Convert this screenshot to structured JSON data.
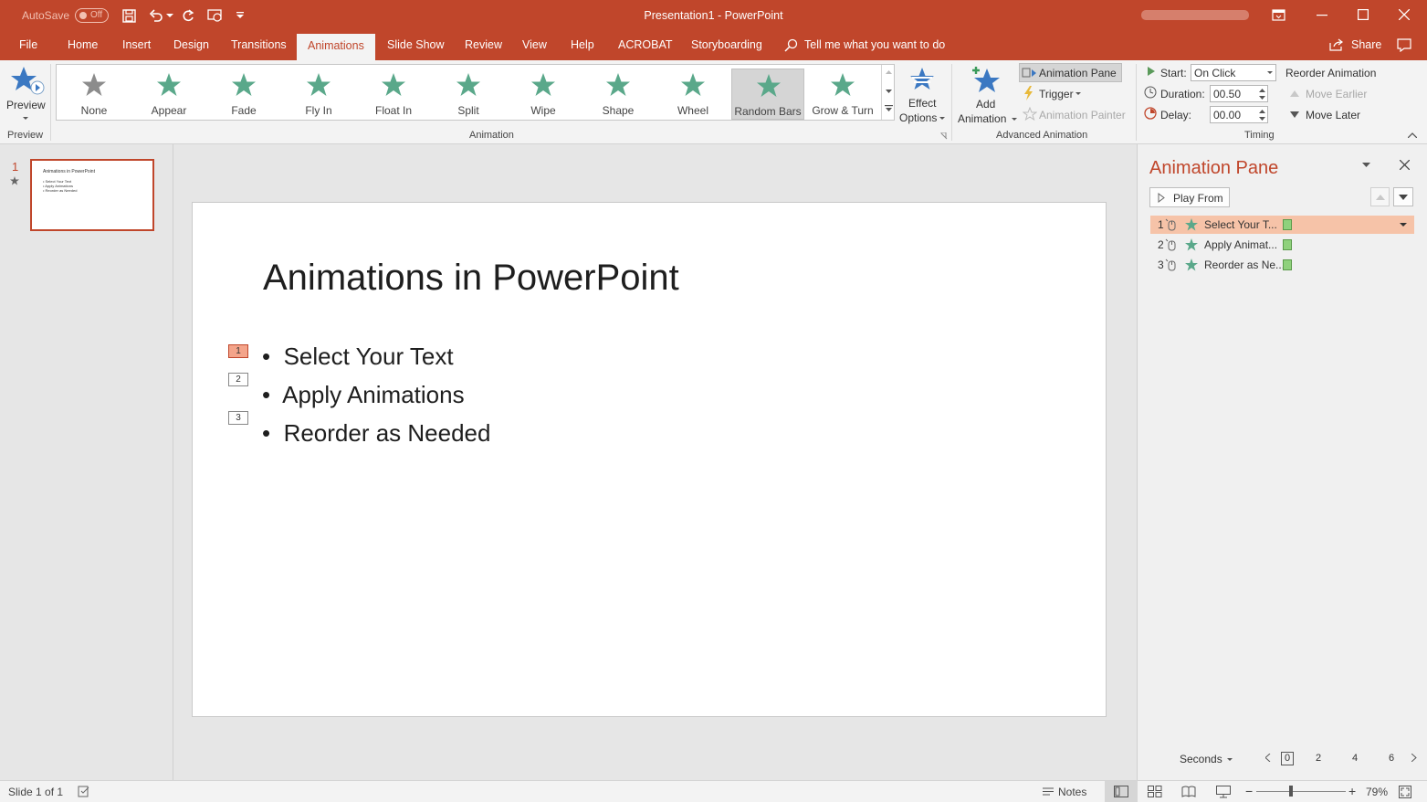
{
  "window": {
    "title": "Presentation1  -  PowerPoint",
    "autosave_label": "AutoSave",
    "autosave_state": "Off"
  },
  "tabs": [
    "File",
    "Home",
    "Insert",
    "Design",
    "Transitions",
    "Animations",
    "Slide Show",
    "Review",
    "View",
    "Help",
    "ACROBAT",
    "Storyboarding"
  ],
  "active_tab": "Animations",
  "tell_me": "Tell me what you want to do",
  "share_label": "Share",
  "ribbon": {
    "preview_label": "Preview",
    "preview_group": "Preview",
    "animation_group": "Animation",
    "gallery": [
      "None",
      "Appear",
      "Fade",
      "Fly In",
      "Float In",
      "Split",
      "Wipe",
      "Shape",
      "Wheel",
      "Random Bars",
      "Grow & Turn"
    ],
    "selected_effect": "Random Bars",
    "effect_options_line1": "Effect",
    "effect_options_line2": "Options",
    "add_animation_line1": "Add",
    "add_animation_line2": "Animation",
    "animation_pane_btn": "Animation Pane",
    "trigger": "Trigger",
    "animation_painter": "Animation Painter",
    "advanced_group": "Advanced Animation",
    "start_label": "Start:",
    "start_value": "On Click",
    "duration_label": "Duration:",
    "duration_value": "00.50",
    "delay_label": "Delay:",
    "delay_value": "00.00",
    "reorder_title": "Reorder Animation",
    "move_earlier": "Move Earlier",
    "move_later": "Move Later",
    "timing_group": "Timing"
  },
  "thumbnails": {
    "number": "1",
    "title": "Animations in PowerPoint",
    "lines": [
      "Select Your Text",
      "Apply Animations",
      "Reorder as Needed"
    ]
  },
  "slide": {
    "title": "Animations in PowerPoint",
    "bullets": [
      "Select Your Text",
      "Apply Animations",
      "Reorder as Needed"
    ],
    "tags": [
      "1",
      "2",
      "3"
    ]
  },
  "animation_pane": {
    "title": "Animation Pane",
    "play_from": "Play From",
    "items": [
      {
        "num": "1",
        "label": "Select Your T..."
      },
      {
        "num": "2",
        "label": "Apply Animat..."
      },
      {
        "num": "3",
        "label": "Reorder as Ne..."
      }
    ],
    "seconds_label": "Seconds",
    "timeline_ticks": [
      "0",
      "2",
      "4",
      "6"
    ]
  },
  "status": {
    "slide_info": "Slide 1 of 1",
    "notes": "Notes",
    "zoom": "79%"
  },
  "colors": {
    "accent": "#c0462b",
    "star_green": "#5aa88a",
    "selected_row": "#f6c3a8"
  }
}
